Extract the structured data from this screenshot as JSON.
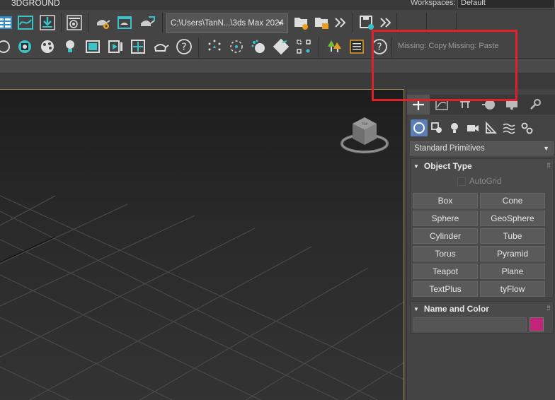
{
  "app": {
    "title": "3DGROUND",
    "workspace_label": "Workspaces:",
    "workspace_value": "Default"
  },
  "toolbar": {
    "project_path": "C:\\Users\\TanN...\\3ds Max 2024",
    "missing_copy": "Missing: Copy",
    "missing_paste": "Missing: Paste",
    "more_icon": "chevron-double-right-icon"
  },
  "command_panel": {
    "tabs": [
      "create",
      "modify",
      "hierarchy",
      "motion",
      "display",
      "utilities"
    ],
    "active_tab": "create",
    "subtabs": [
      "geometry",
      "shapes",
      "lights",
      "cameras",
      "helpers",
      "space-warps",
      "systems"
    ],
    "active_subtab": "geometry",
    "category": "Standard Primitives",
    "object_type": {
      "title": "Object Type",
      "autogrid_label": "AutoGrid",
      "buttons": [
        "Box",
        "Cone",
        "Sphere",
        "GeoSphere",
        "Cylinder",
        "Tube",
        "Torus",
        "Pyramid",
        "Teapot",
        "Plane",
        "TextPlus",
        "tyFlow"
      ]
    },
    "name_and_color": {
      "title": "Name and Color",
      "name_value": "",
      "color": "#c2247a"
    }
  },
  "colors": {
    "viewport_border": "#9b8a54",
    "highlight": "#e0202a",
    "accent_cyan": "#38c4c9",
    "active_subtab": "#5b7fb4"
  }
}
